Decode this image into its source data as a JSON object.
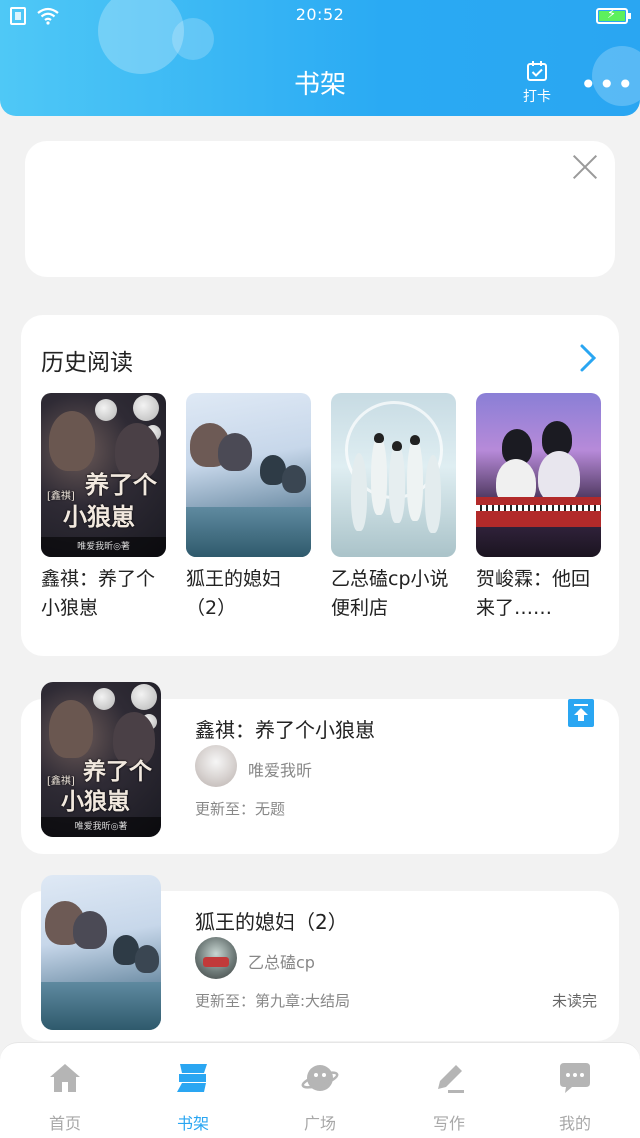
{
  "status_bar": {
    "time": "20:52"
  },
  "header": {
    "title": "书架",
    "checkin_label": "打卡",
    "more_label": "•••"
  },
  "history": {
    "title": "历史阅读",
    "items": [
      {
        "name": "鑫祺：养了个小狼崽",
        "cover": "cover-1"
      },
      {
        "name": "狐王的媳妇（2）",
        "cover": "cover-2"
      },
      {
        "name": "乙总磕cp小说便利店",
        "cover": "cover-3"
      },
      {
        "name": "贺峻霖：他回来了……",
        "cover": "cover-4"
      }
    ]
  },
  "cover_art": {
    "title_line1": "养了个",
    "title_line2": "小狼崽",
    "tag": "[鑫祺]",
    "byline": "唯爱我昕◎著"
  },
  "books": [
    {
      "title": "鑫祺：养了个小狼崽",
      "author": "唯爱我昕",
      "update": "更新至：无题",
      "status": ""
    },
    {
      "title": "狐王的媳妇（2）",
      "author": "乙总磕cp",
      "update": "更新至：第九章:大结局",
      "status": "未读完"
    }
  ],
  "nav": {
    "items": [
      {
        "label": "首页",
        "icon": "home-icon",
        "active": false
      },
      {
        "label": "书架",
        "icon": "bookshelf-icon",
        "active": true
      },
      {
        "label": "广场",
        "icon": "square-icon",
        "active": false
      },
      {
        "label": "写作",
        "icon": "write-icon",
        "active": false
      },
      {
        "label": "我的",
        "icon": "profile-icon",
        "active": false
      }
    ]
  },
  "colors": {
    "accent": "#2aa6f2",
    "header_gradient_start": "#4fc8f6",
    "inactive": "#a8a8a8"
  }
}
